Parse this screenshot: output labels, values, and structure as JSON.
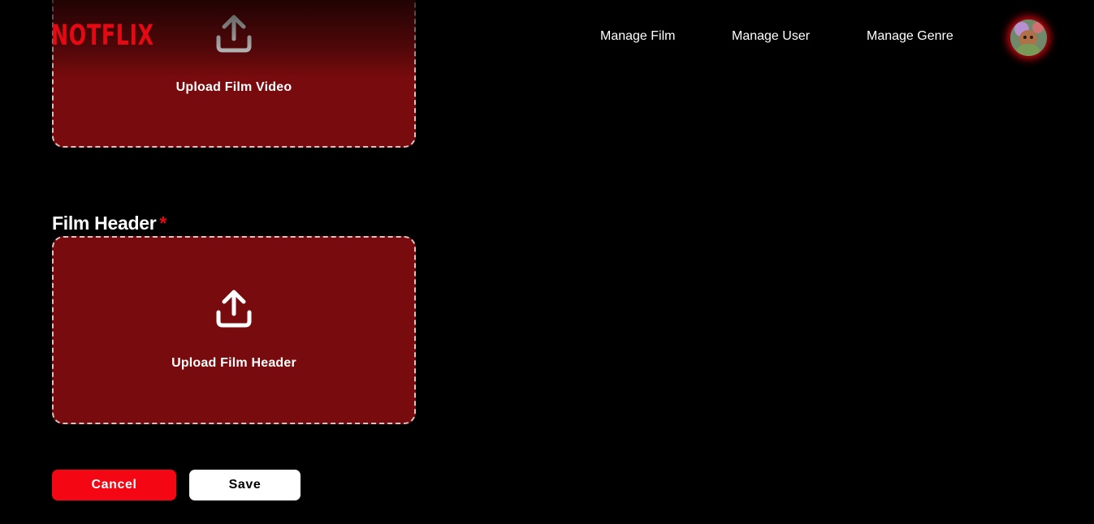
{
  "brand": {
    "logo_text": "NOTFLIX",
    "color": "#e50914"
  },
  "nav": {
    "items": [
      {
        "label": "Manage Film"
      },
      {
        "label": "Manage User"
      },
      {
        "label": "Manage Genre"
      }
    ],
    "avatar_icon": "user-avatar"
  },
  "upload_video": {
    "label": "Upload Film Video",
    "icon": "upload-icon"
  },
  "film_header": {
    "label": "Film Header",
    "required_marker": "*",
    "upload_label": "Upload Film Header",
    "icon": "upload-icon"
  },
  "actions": {
    "cancel_label": "Cancel",
    "save_label": "Save"
  },
  "colors": {
    "background": "#000000",
    "upload_box": "#780b0d",
    "cancel_button": "#f40612",
    "save_button": "#ffffff"
  }
}
